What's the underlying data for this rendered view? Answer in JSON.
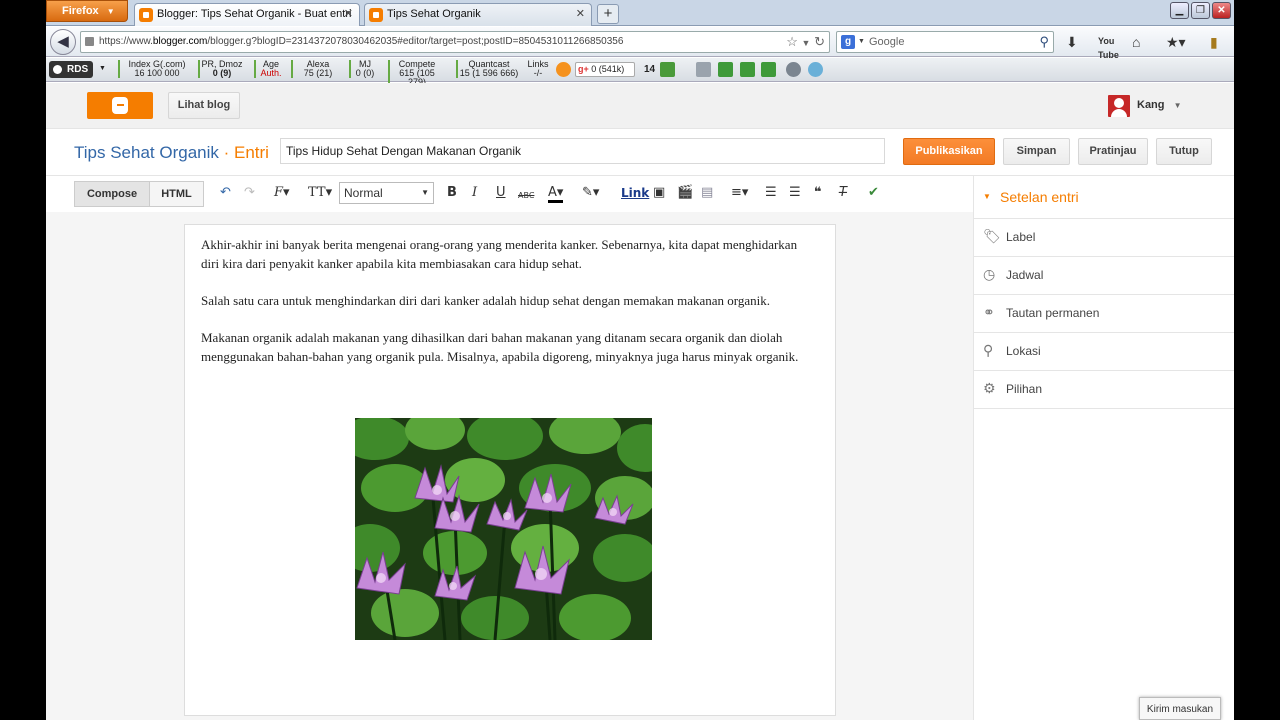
{
  "browser": {
    "app_button": "Firefox",
    "tabs": [
      {
        "title": "Blogger: Tips Sehat Organik - Buat entri",
        "active": true
      },
      {
        "title": "Tips Sehat Organik",
        "active": false
      }
    ],
    "url_prefix": "https://www.",
    "url_domain": "blogger.com",
    "url_rest": "/blogger.g?blogID=2314372078030462035#editor/target=post;postID=8504531011266850356",
    "search_placeholder": "Google"
  },
  "seo_bar": {
    "rds": "RDS",
    "items": [
      {
        "label": "Index G(.com)",
        "value": "16 100 000"
      },
      {
        "label": "PR, Dmoz",
        "value": "0 (9)"
      },
      {
        "label": "Age",
        "value": "Auth."
      },
      {
        "label": "Alexa",
        "value": "75 (21)"
      },
      {
        "label": "MJ",
        "value": "0 (0)"
      },
      {
        "label": "Compete",
        "value": "615 (105 279)"
      },
      {
        "label": "Quantcast",
        "value": "15 (1 596 666)"
      },
      {
        "label": "Links",
        "value": "-/-"
      }
    ],
    "gplus": "0 (541k)",
    "count": "14"
  },
  "blogger": {
    "view_blog": "Lihat blog",
    "user": "Kang",
    "blog_name": "Tips Sehat Organik",
    "separator": " · ",
    "section": "Entri",
    "post_title": "Tips Hidup Sehat Dengan Makanan Organik",
    "actions": {
      "publish": "Publikasikan",
      "save": "Simpan",
      "preview": "Pratinjau",
      "close": "Tutup"
    }
  },
  "toolbar": {
    "compose": "Compose",
    "html": "HTML",
    "format": "Normal",
    "bold": "B",
    "italic": "I",
    "underline": "U",
    "strike": "ABC",
    "link": "Link"
  },
  "post": {
    "paragraphs": [
      "Akhir-akhir ini banyak berita mengenai orang-orang yang menderita kanker. Sebenarnya, kita dapat menghidarkan diri kira dari penyakit kanker apabila kita membiasakan cara hidup sehat.",
      "Salah satu cara untuk menghindarkan diri dari kanker adalah hidup sehat dengan memakan makanan organik.",
      "Makanan organik adalah makanan yang dihasilkan dari bahan makanan yang ditanam secara organik dan diolah menggunakan bahan-bahan yang organik pula. Misalnya, apabila digoreng, minyaknya juga harus minyak organik."
    ]
  },
  "sidebar": {
    "header": "Setelan entri",
    "items": [
      {
        "label": "Label",
        "icon": "tag-icon"
      },
      {
        "label": "Jadwal",
        "icon": "clock-icon"
      },
      {
        "label": "Tautan permanen",
        "icon": "link-icon"
      },
      {
        "label": "Lokasi",
        "icon": "location-pin-icon"
      },
      {
        "label": "Pilihan",
        "icon": "gear-icon"
      }
    ]
  },
  "feedback": "Kirim masukan",
  "colors": {
    "accent": "#f57d00",
    "blog_blue": "#3367a7",
    "publish": "#f37b25"
  }
}
